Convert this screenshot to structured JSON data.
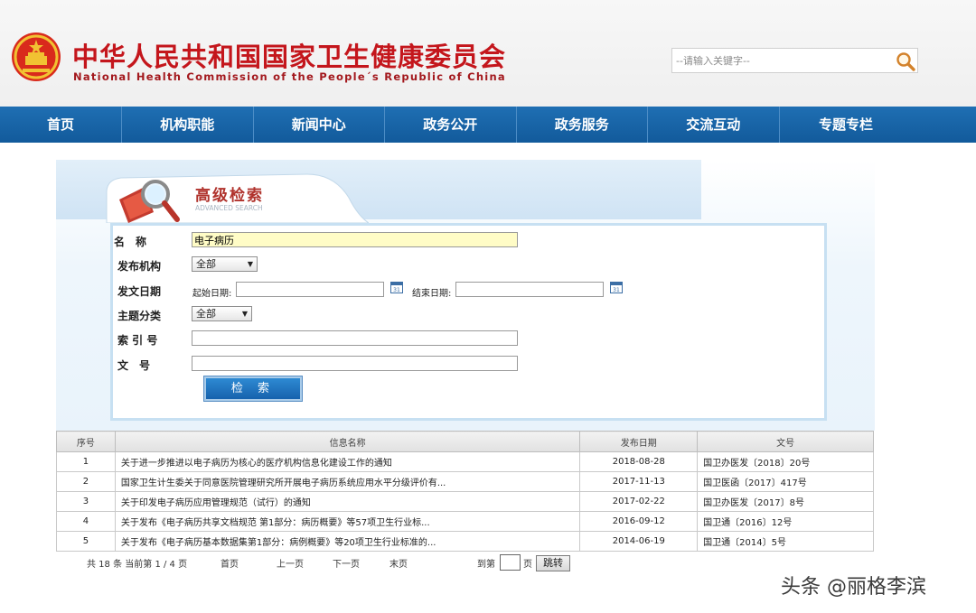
{
  "header": {
    "title": "中华人民共和国国家卫生健康委员会",
    "subtitle": "National Health Commission of the People´s Republic of China",
    "search_placeholder": "--请输入关键字--"
  },
  "nav": {
    "items": [
      "首页",
      "机构职能",
      "新闻中心",
      "政务公开",
      "政务服务",
      "交流互动",
      "专题专栏"
    ]
  },
  "panel": {
    "title": "高级检索",
    "title_en": "ADVANCED SEARCH",
    "form": {
      "name_label": "名　称",
      "name_value": "电子病历",
      "org_label": "发布机构",
      "org_value": "全部",
      "date_label": "发文日期",
      "start_label": "起始日期:",
      "end_label": "结束日期:",
      "topic_label": "主题分类",
      "topic_value": "全部",
      "index_label": "索 引 号",
      "doc_label": "文　号",
      "submit_label": "检 索"
    }
  },
  "results": {
    "headers": [
      "序号",
      "信息名称",
      "发布日期",
      "文号"
    ],
    "rows": [
      {
        "no": "1",
        "title": "关于进一步推进以电子病历为核心的医疗机构信息化建设工作的通知",
        "date": "2018-08-28",
        "doc": "国卫办医发〔2018〕20号"
      },
      {
        "no": "2",
        "title": "国家卫生计生委关于同意医院管理研究所开展电子病历系统应用水平分级评价有...",
        "date": "2017-11-13",
        "doc": "国卫医函〔2017〕417号"
      },
      {
        "no": "3",
        "title": "关于印发电子病历应用管理规范（试行）的通知",
        "date": "2017-02-22",
        "doc": "国卫办医发〔2017〕8号"
      },
      {
        "no": "4",
        "title": "关于发布《电子病历共享文档规范 第1部分：病历概要》等57项卫生行业标...",
        "date": "2016-09-12",
        "doc": "国卫通〔2016〕12号"
      },
      {
        "no": "5",
        "title": "关于发布《电子病历基本数据集第1部分：病例概要》等20项卫生行业标准的...",
        "date": "2014-06-19",
        "doc": "国卫通〔2014〕5号"
      }
    ]
  },
  "pager": {
    "summary": "共 18 条 当前第 1 / 4 页",
    "first": "首页",
    "prev": "上一页",
    "next": "下一页",
    "last": "末页",
    "goto_prefix": "到第",
    "goto_suffix": "页",
    "go_button": "跳转"
  },
  "watermark": "头条 @丽格李滨",
  "colors": {
    "brand_red": "#c4161c",
    "nav_blue": "#1a66aa"
  }
}
